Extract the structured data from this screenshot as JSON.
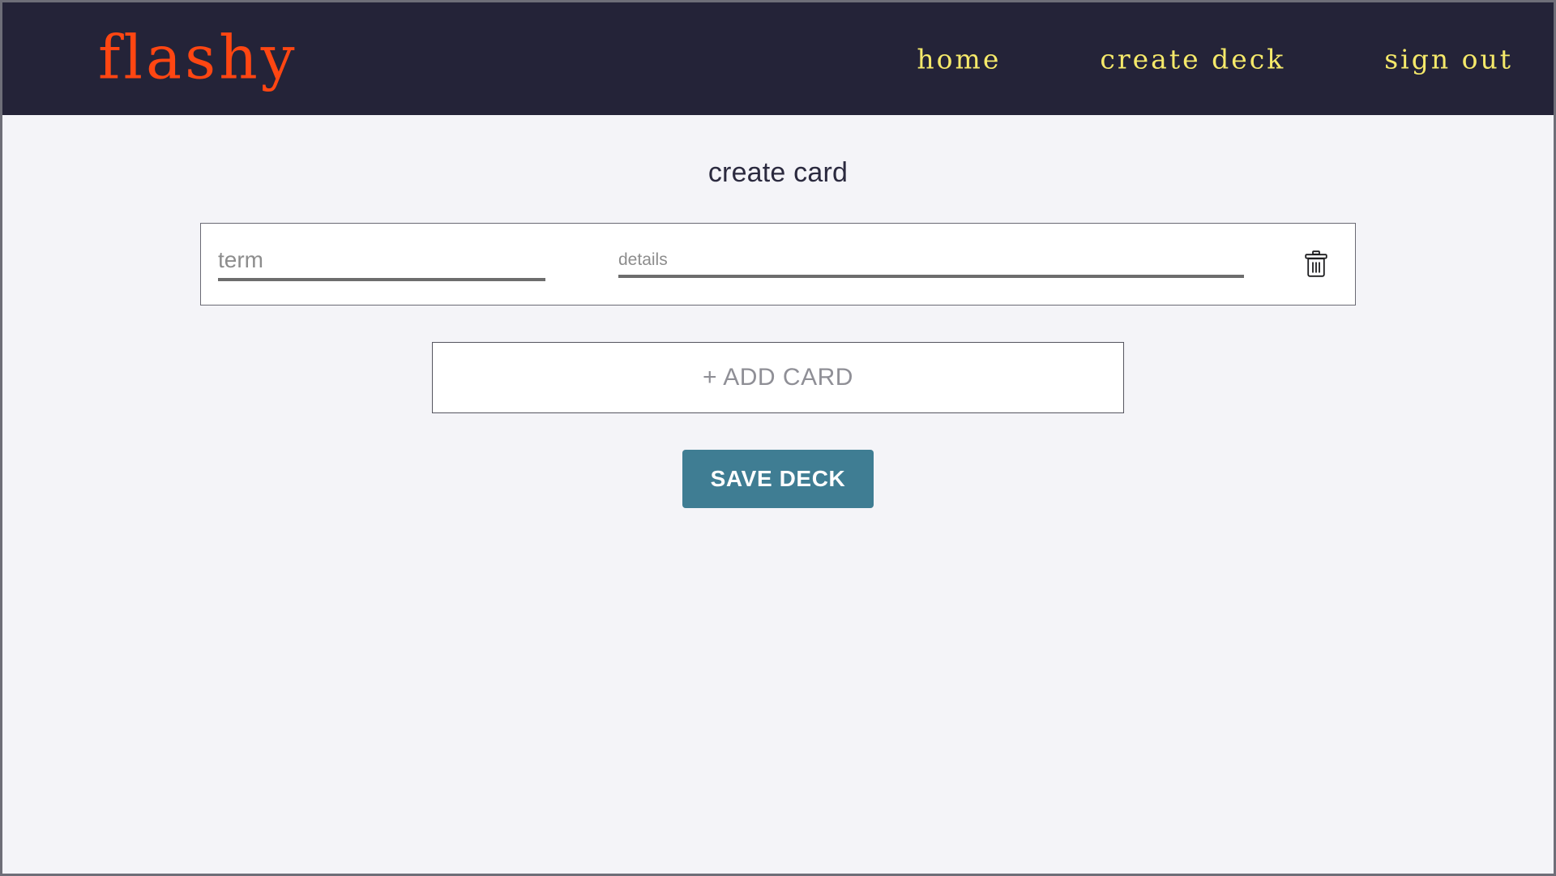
{
  "header": {
    "logo": "flashy",
    "nav": [
      {
        "label": "home",
        "name": "nav-link-home"
      },
      {
        "label": "create deck",
        "name": "nav-link-create-deck"
      },
      {
        "label": "sign out",
        "name": "nav-link-sign-out"
      }
    ]
  },
  "main": {
    "title": "create card",
    "card": {
      "term": {
        "value": "",
        "placeholder": "term"
      },
      "details": {
        "value": "",
        "placeholder": "details"
      },
      "delete_icon": "trash-icon"
    },
    "add_card_label": "+ ADD CARD",
    "save_deck_label": "SAVE DECK"
  },
  "colors": {
    "header_bg": "#242338",
    "logo": "#ff4612",
    "nav_text": "#f5e96a",
    "page_bg": "#f4f4f8",
    "title_text": "#2b2a3f",
    "save_button_bg": "#3f7d93",
    "save_button_text": "#ffffff",
    "placeholder_text": "#8d8d8d",
    "input_underline": "#6d6d6d",
    "add_card_text": "#8f8f96"
  }
}
